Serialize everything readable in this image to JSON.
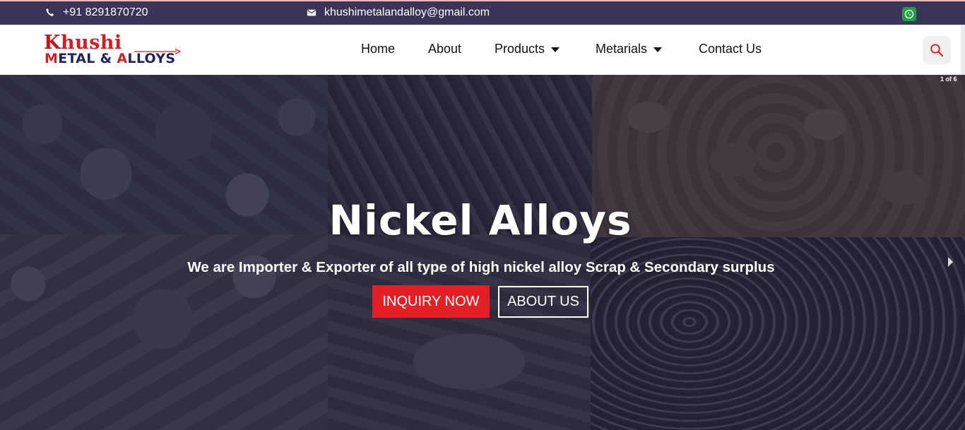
{
  "topbar": {
    "phone": "+91 8291870720",
    "email": "khushimetalandalloy@gmail.com",
    "phone_icon": "phone-icon",
    "email_icon": "mail-icon",
    "social_icon": "whatsapp-icon"
  },
  "logo": {
    "line1_first": "K",
    "line1_rest": "hushi",
    "line2_a": "M",
    "line2_b": "ETAL & ",
    "line2_c": "A",
    "line2_d": "LLOYS"
  },
  "nav": {
    "items": [
      {
        "label": "Home"
      },
      {
        "label": "About"
      },
      {
        "label": "Products"
      },
      {
        "label": "Metarials"
      },
      {
        "label": "Contact Us"
      }
    ],
    "search_icon": "search-icon"
  },
  "hero": {
    "slide_counter": "1 of 6",
    "title": "Nickel Alloys",
    "subtitle": "We are Importer & Exporter of all type of high nickel alloy Scrap & Secondary surplus",
    "inquiry_label": "INQUIRY NOW",
    "about_label": "ABOUT US"
  },
  "colors": {
    "topbar_bg": "#3a3557",
    "accent_red": "#e41f26",
    "logo_navy": "#21235f",
    "whatsapp_green": "#1f9f45"
  }
}
